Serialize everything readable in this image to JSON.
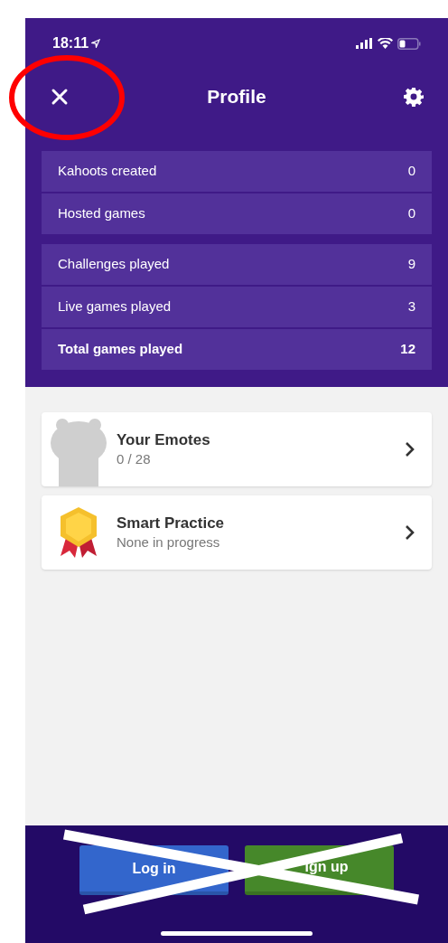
{
  "status_bar": {
    "time": "18:11"
  },
  "header": {
    "title": "Profile"
  },
  "stat_groups": [
    {
      "rows": [
        {
          "label": "Kahoots created",
          "value": "0",
          "bold": false
        },
        {
          "label": "Hosted games",
          "value": "0",
          "bold": false
        }
      ]
    },
    {
      "rows": [
        {
          "label": "Challenges played",
          "value": "9",
          "bold": false
        },
        {
          "label": "Live games played",
          "value": "3",
          "bold": false
        },
        {
          "label": "Total games played",
          "value": "12",
          "bold": true
        }
      ]
    }
  ],
  "cards": [
    {
      "kind": "emotes",
      "title": "Your Emotes",
      "subtitle": "0 / 28"
    },
    {
      "kind": "practice",
      "title": "Smart Practice",
      "subtitle": "None in progress"
    }
  ],
  "buttons": [
    {
      "label": "Log in",
      "kind": "login"
    },
    {
      "label": "ign up",
      "kind": "signup"
    }
  ]
}
